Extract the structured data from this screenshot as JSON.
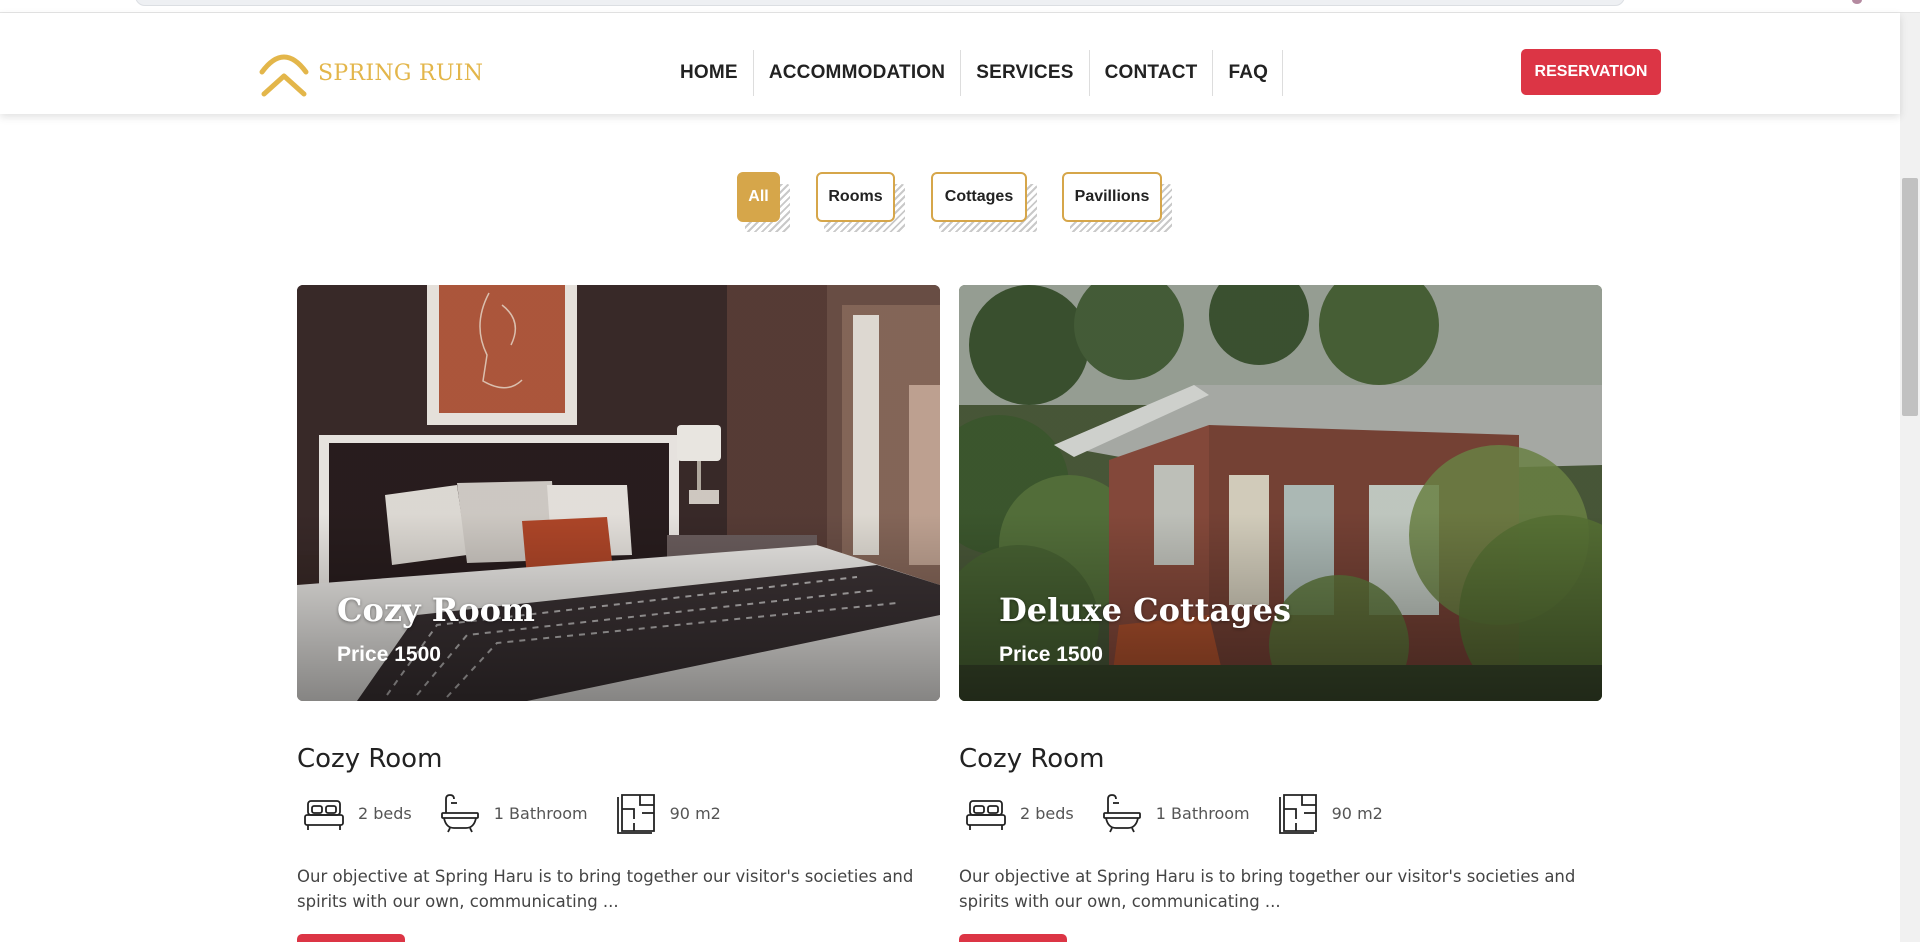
{
  "brand": {
    "name": "SPRING RUIN",
    "accent_color": "#e3b64a"
  },
  "nav": {
    "items": [
      "HOME",
      "ACCOMMODATION",
      "SERVICES",
      "CONTACT",
      "FAQ"
    ],
    "reservation_label": "RESERVATION",
    "reservation_color": "#dc3545"
  },
  "filters": [
    {
      "label": "All",
      "active": true
    },
    {
      "label": "Rooms",
      "active": false
    },
    {
      "label": "Cottages",
      "active": false
    },
    {
      "label": "Pavillions",
      "active": false
    }
  ],
  "cards": [
    {
      "image_name": "Cozy Room",
      "image_price": "Price 1500",
      "title": "Cozy Room",
      "beds": "2  beds",
      "bathrooms": "1 Bathroom",
      "area": "90   m2",
      "description": "Our objective at Spring Haru is to bring together our visitor's societies and spirits with our own, communicating ..."
    },
    {
      "image_name": "Deluxe Cottages",
      "image_price": "Price 1500",
      "title": "Cozy Room",
      "beds": "2  beds",
      "bathrooms": "1 Bathroom",
      "area": "90   m2",
      "description": "Our objective at Spring Haru is to bring together our visitor's societies and spirits with our own, communicating ..."
    }
  ]
}
